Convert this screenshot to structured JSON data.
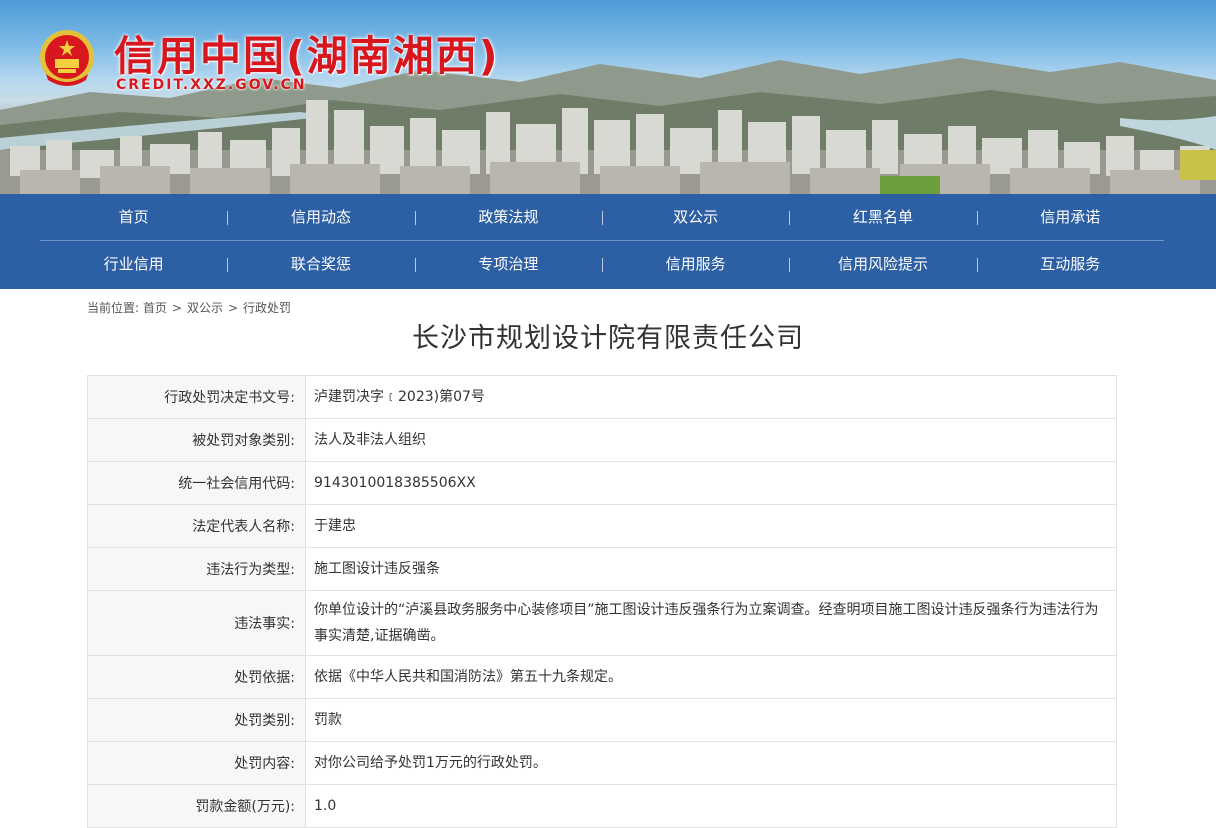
{
  "header": {
    "site_name": "信用中国(湖南湘西)",
    "site_domain": "CREDIT.XXZ.GOV.CN",
    "colors": {
      "title_red": "#d8161e",
      "nav_blue": "#2c5fa4"
    }
  },
  "nav": {
    "row1": [
      "首页",
      "信用动态",
      "政策法规",
      "双公示",
      "红黑名单",
      "信用承诺"
    ],
    "row2": [
      "行业信用",
      "联合奖惩",
      "专项治理",
      "信用服务",
      "信用风险提示",
      "互动服务"
    ]
  },
  "breadcrumb": {
    "prefix": "当前位置:",
    "items": [
      "首页",
      "双公示",
      "行政处罚"
    ],
    "separator": ">"
  },
  "page": {
    "title": "长沙市规划设计院有限责任公司"
  },
  "record": [
    {
      "label": "行政处罚决定书文号:",
      "value": "泸建罚决字﹝2023)第07号"
    },
    {
      "label": "被处罚对象类别:",
      "value": "法人及非法人组织"
    },
    {
      "label": "统一社会信用代码:",
      "value": "9143010018385506XX"
    },
    {
      "label": "法定代表人名称:",
      "value": "于建忠"
    },
    {
      "label": "违法行为类型:",
      "value": "施工图设计违反强条"
    },
    {
      "label": "违法事实:",
      "value": "你单位设计的“泸溪县政务服务中心装修项目”施工图设计违反强条行为立案调查。经查明项目施工图设计违反强条行为违法行为事实清楚,证据确凿。"
    },
    {
      "label": "处罚依据:",
      "value": "依据《中华人民共和国消防法》第五十九条规定。"
    },
    {
      "label": "处罚类别:",
      "value": "罚款"
    },
    {
      "label": "处罚内容:",
      "value": "对你公司给予处罚1万元的行政处罚。"
    },
    {
      "label": "罚款金额(万元):",
      "value": "1.0"
    }
  ]
}
